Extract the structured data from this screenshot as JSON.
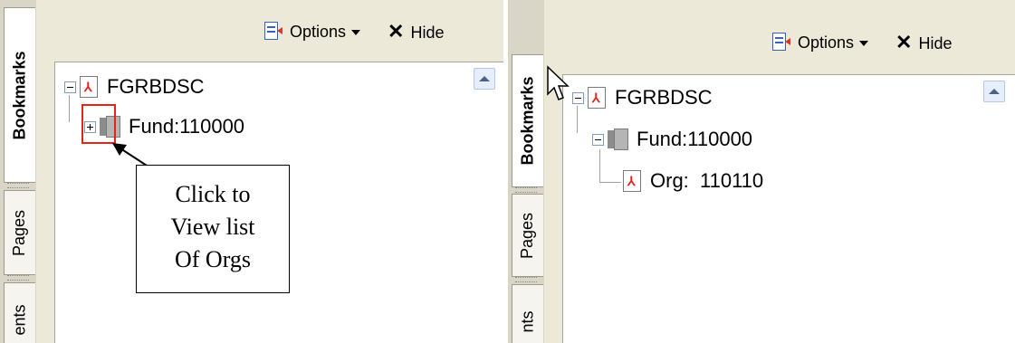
{
  "left_panel": {
    "tabs": [
      "Bookmarks",
      "Pages",
      "ents"
    ],
    "toolbar": {
      "options_label": "Options",
      "hide_label": "Hide"
    },
    "tree": {
      "root_label": "FGRBDSC",
      "child_label": "Fund:110000",
      "child_state": "collapsed"
    },
    "callout": {
      "line1": "Click to",
      "line2": "View list",
      "line3": "Of Orgs"
    }
  },
  "right_panel": {
    "tabs": [
      "Bookmarks",
      "Pages",
      "nts"
    ],
    "toolbar": {
      "options_label": "Options",
      "hide_label": "Hide"
    },
    "tree": {
      "root_label": "FGRBDSC",
      "child_label": "Fund:110000",
      "child_state": "expanded",
      "grandchild_label": "Org:  110110"
    }
  },
  "icons": {
    "toolbar_icon": "bookmark-options-icon",
    "root_icon": "pdf-bookmark-icon",
    "fund_icon": "gray-pages-icon",
    "org_icon": "pdf-bookmark-icon",
    "hide": "close-x-icon",
    "options": "chevron-down-icon"
  },
  "colors": {
    "panel": "#ece9d8",
    "highlight": "#e32419",
    "pdf_red": "#e0231b"
  }
}
